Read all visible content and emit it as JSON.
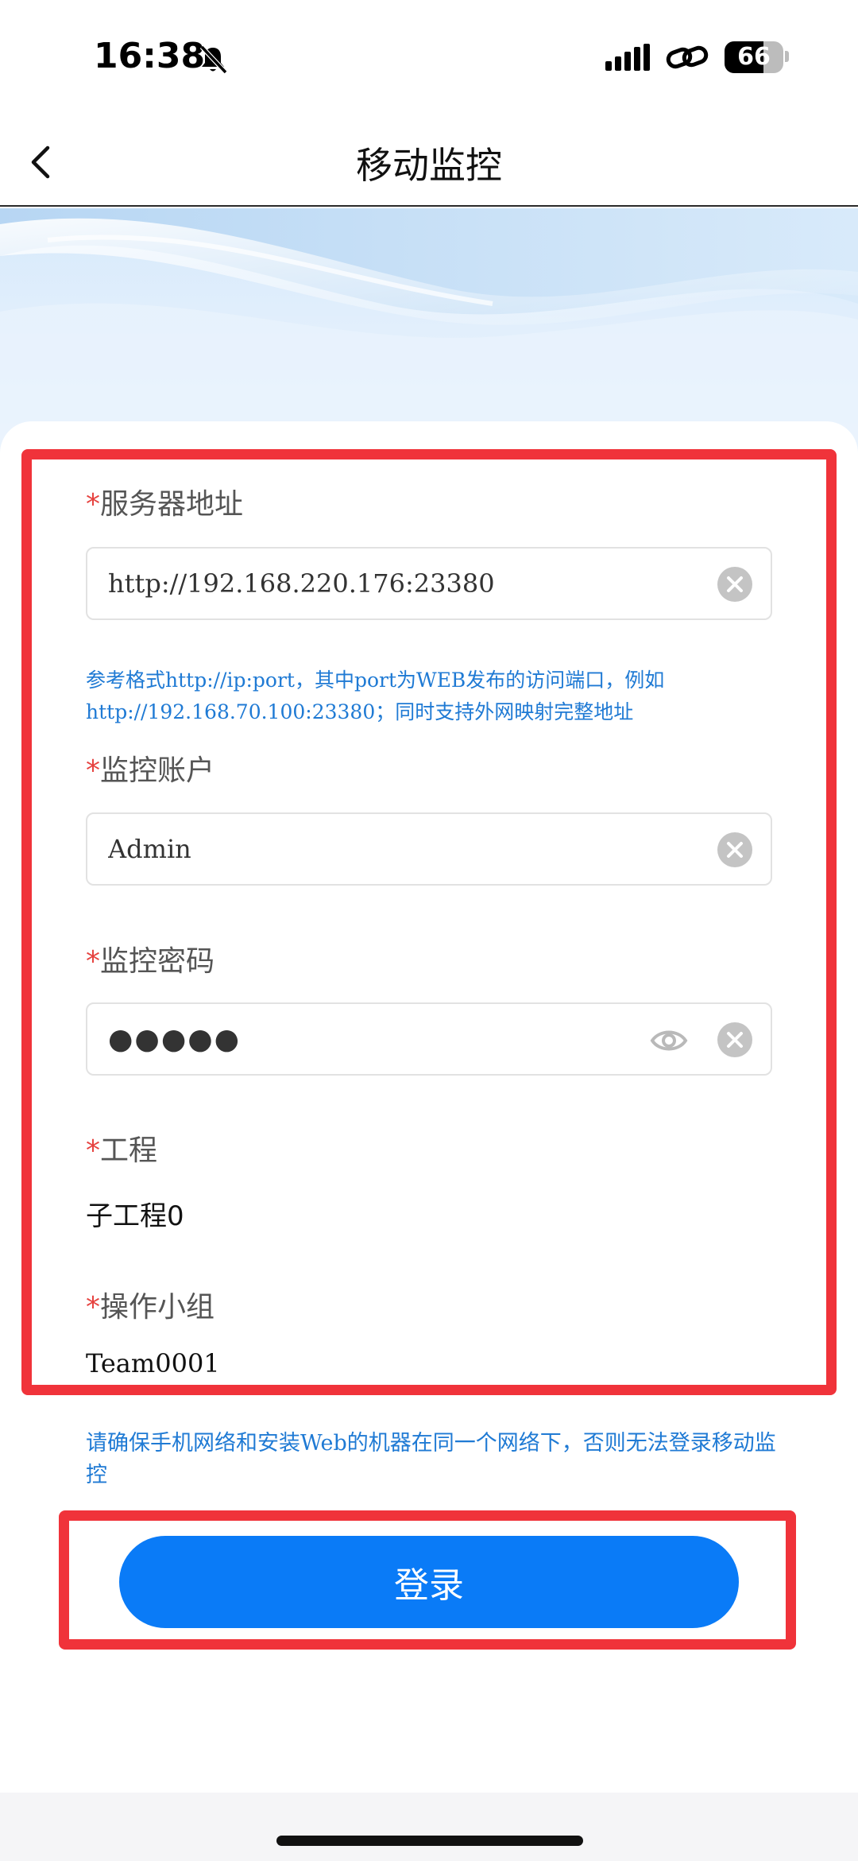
{
  "status_bar": {
    "time": "16:38",
    "battery": "66",
    "icons": [
      "bell-muted-icon",
      "signal-icon",
      "link-icon",
      "battery-icon"
    ]
  },
  "nav": {
    "title": "移动监控",
    "back_icon": "chevron-left-icon"
  },
  "form": {
    "server": {
      "label": "服务器地址",
      "value": "http://192.168.220.176:23380"
    },
    "server_hint": "参考格式http://ip:port，其中port为WEB发布的访问端口，例如http://192.168.70.100:23380；同时支持外网映射完整地址",
    "account": {
      "label": "监控账户",
      "value": "Admin"
    },
    "password": {
      "label": "监控密码",
      "value": "●●●●●"
    },
    "project": {
      "label": "工程",
      "value": "子工程0"
    },
    "team": {
      "label": "操作小组",
      "value": "Team0001"
    },
    "required_mark": "*"
  },
  "network_hint": "请确保手机网络和安装Web的机器在同一个网络下，否则无法登录移动监控",
  "login_button": "登录",
  "colors": {
    "primary": "#0a7bf7",
    "hint": "#1f7ad4",
    "required": "#e64340",
    "annotation": "#f0333a"
  }
}
